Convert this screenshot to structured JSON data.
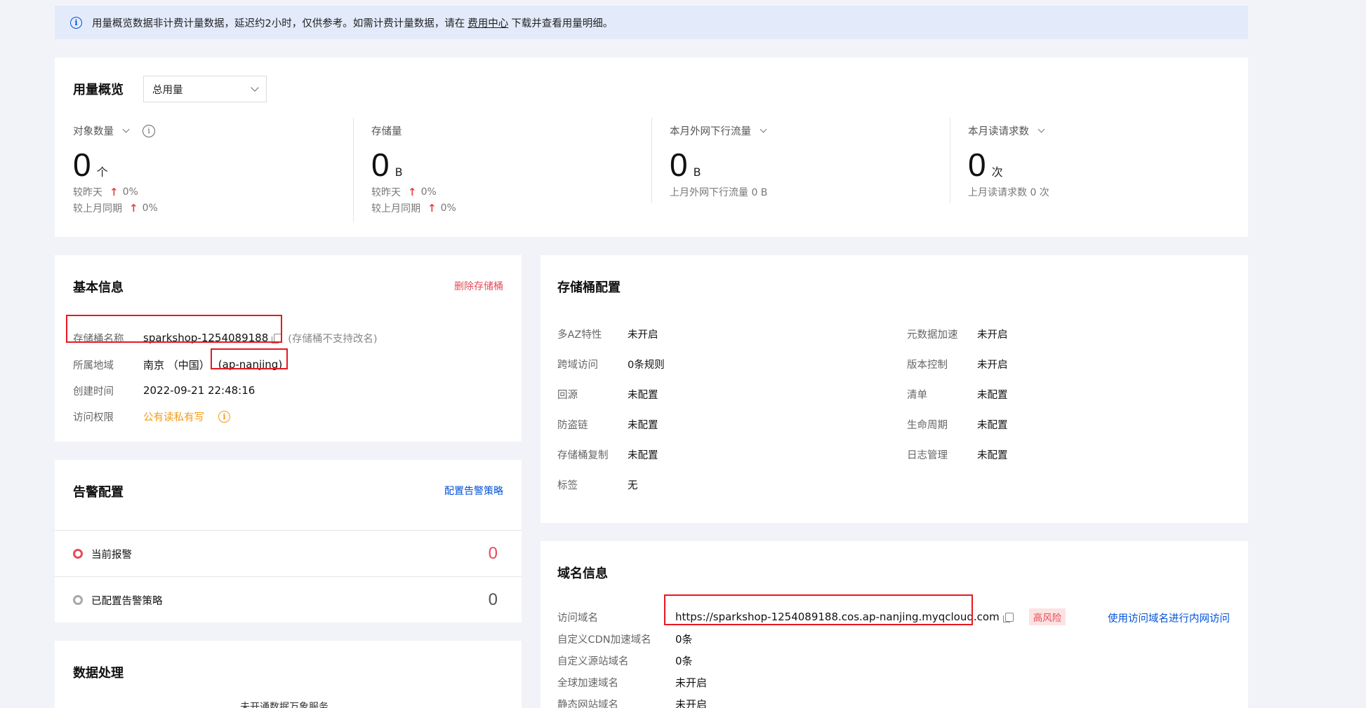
{
  "notice": {
    "text_before": "用量概览数据非计费计量数据，延迟约2小时，仅供参考。如需计费计量数据，请在",
    "link": "费用中心",
    "text_after": "下载并查看用量明细。"
  },
  "usage": {
    "title": "用量概览",
    "select_value": "总用量",
    "metrics": [
      {
        "label": "对象数量",
        "value": "0",
        "unit": "个",
        "sub1_label": "较昨天",
        "sub1_value": "0%",
        "sub2_label": "较上月同期",
        "sub2_value": "0%"
      },
      {
        "label": "存储量",
        "value": "0",
        "unit": "B",
        "sub1_label": "较昨天",
        "sub1_value": "0%",
        "sub2_label": "较上月同期",
        "sub2_value": "0%"
      },
      {
        "label": "本月外网下行流量",
        "value": "0",
        "unit": "B",
        "sub1_label": "上月外网下行流量 0 B"
      },
      {
        "label": "本月读请求数",
        "value": "0",
        "unit": "次",
        "sub1_label": "上月读请求数 0 次"
      }
    ]
  },
  "basic": {
    "title": "基本信息",
    "delete_link": "删除存储桶",
    "name_label": "存储桶名称",
    "name_value": "sparkshop-1254089188",
    "name_hint": "(存储桶不支持改名)",
    "region_label": "所属地域",
    "region_value": "南京 （中国）",
    "region_code": "(ap-nanjing)",
    "created_label": "创建时间",
    "created_value": "2022-09-21 22:48:16",
    "acl_label": "访问权限",
    "acl_value": "公有读私有写"
  },
  "alarm": {
    "title": "告警配置",
    "config_link": "配置告警策略",
    "current_label": "当前报警",
    "current_count": "0",
    "configured_label": "已配置告警策略",
    "configured_count": "0"
  },
  "dataproc": {
    "title": "数据处理",
    "sub": "未开通数据万象服务"
  },
  "bucket_config": {
    "title": "存储桶配置",
    "left": [
      {
        "k": "多AZ特性",
        "v": "未开启"
      },
      {
        "k": "跨域访问",
        "v": "0条规则"
      },
      {
        "k": "回源",
        "v": "未配置"
      },
      {
        "k": "防盗链",
        "v": "未配置"
      },
      {
        "k": "存储桶复制",
        "v": "未配置"
      },
      {
        "k": "标签",
        "v": "无"
      }
    ],
    "right": [
      {
        "k": "元数据加速",
        "v": "未开启"
      },
      {
        "k": "版本控制",
        "v": "未开启"
      },
      {
        "k": "清单",
        "v": "未配置"
      },
      {
        "k": "生命周期",
        "v": "未配置"
      },
      {
        "k": "日志管理",
        "v": "未配置"
      }
    ]
  },
  "domain": {
    "title": "域名信息",
    "access_label": "访问域名",
    "access_value": "https://sparkshop-1254089188.cos.ap-nanjing.myqcloud.com",
    "risk_badge": "高风险",
    "intranet_link": "使用访问域名进行内网访问",
    "rows": [
      {
        "k": "自定义CDN加速域名",
        "v": "0条"
      },
      {
        "k": "自定义源站域名",
        "v": "0条"
      },
      {
        "k": "全球加速域名",
        "v": "未开启"
      },
      {
        "k": "静态网站域名",
        "v": "未开启"
      }
    ]
  },
  "colors": {
    "accent": "#0052d9",
    "danger": "#e34d59",
    "warning": "#f39a14",
    "highlight_box": "#e8181f"
  }
}
